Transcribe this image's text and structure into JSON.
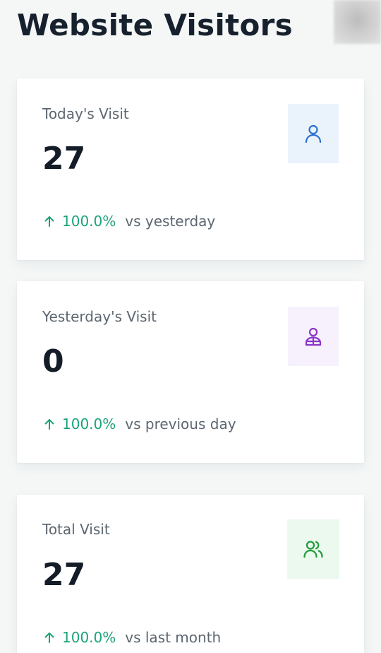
{
  "page": {
    "title": "Website Visitors"
  },
  "colors": {
    "trend_up": "#1aa37a",
    "today_icon": "#2a6fd1",
    "today_icon_bg": "#eaf3fc",
    "yesterday_icon": "#8a35c8",
    "yesterday_icon_bg": "#f6f1fc",
    "total_icon": "#1e9a3c",
    "total_icon_bg": "#ecf9ee"
  },
  "cards": [
    {
      "label": "Today's Visit",
      "value": "27",
      "trend_percent": "100.0%",
      "trend_text": "vs yesterday",
      "trend_direction": "up",
      "icon": "user-icon"
    },
    {
      "label": "Yesterday's Visit",
      "value": "0",
      "trend_percent": "100.0%",
      "trend_text": "vs previous day",
      "trend_direction": "up",
      "icon": "user-badge-icon"
    },
    {
      "label": "Total Visit",
      "value": "27",
      "trend_percent": "100.0%",
      "trend_text": "vs last month",
      "trend_direction": "up",
      "icon": "users-icon"
    }
  ]
}
